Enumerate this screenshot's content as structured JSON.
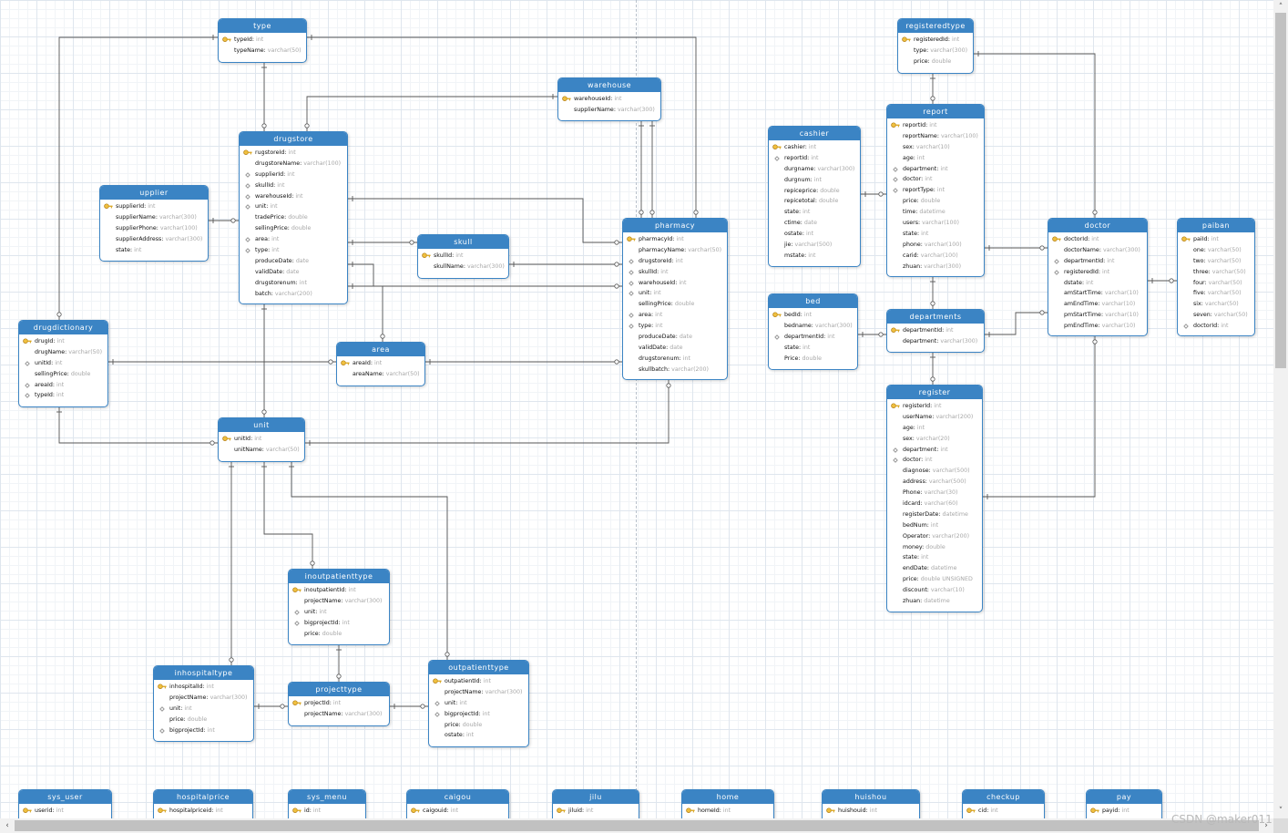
{
  "diagram": {
    "tables": [
      {
        "name": "type",
        "fields": [
          {
            "name": "typeId",
            "type": "int",
            "key": "pk"
          },
          {
            "name": "typeName",
            "type": "varchar(50)",
            "key": ""
          }
        ]
      },
      {
        "name": "warehouse",
        "fields": [
          {
            "name": "warehouseId",
            "type": "int",
            "key": "pk"
          },
          {
            "name": "supplierName",
            "type": "varchar(300)",
            "key": ""
          }
        ]
      },
      {
        "name": "drugstore",
        "fields": [
          {
            "name": "rugstoreId",
            "type": "int",
            "key": "pk"
          },
          {
            "name": "drugstoreName",
            "type": "varchar(100)",
            "key": ""
          },
          {
            "name": "supplierId",
            "type": "int",
            "key": "fk"
          },
          {
            "name": "skullId",
            "type": "int",
            "key": "fk"
          },
          {
            "name": "warehouseId",
            "type": "int",
            "key": "fk"
          },
          {
            "name": "unit",
            "type": "int",
            "key": "fk"
          },
          {
            "name": "tradePrice",
            "type": "double",
            "key": ""
          },
          {
            "name": "sellingPrice",
            "type": "double",
            "key": ""
          },
          {
            "name": "area",
            "type": "int",
            "key": "fk"
          },
          {
            "name": "type",
            "type": "int",
            "key": "fk"
          },
          {
            "name": "produceDate",
            "type": "date",
            "key": ""
          },
          {
            "name": "validDate",
            "type": "date",
            "key": ""
          },
          {
            "name": "drugstorenum",
            "type": "int",
            "key": ""
          },
          {
            "name": "batch",
            "type": "varchar(200)",
            "key": ""
          }
        ]
      },
      {
        "name": "upplier",
        "fields": [
          {
            "name": "supplierId",
            "type": "int",
            "key": "pk"
          },
          {
            "name": "supplierName",
            "type": "varchar(300)",
            "key": ""
          },
          {
            "name": "supplierPhone",
            "type": "varchar(100)",
            "key": ""
          },
          {
            "name": "supplierAddress",
            "type": "varchar(300)",
            "key": ""
          },
          {
            "name": "state",
            "type": "int",
            "key": ""
          }
        ]
      },
      {
        "name": "skull",
        "fields": [
          {
            "name": "skullId",
            "type": "int",
            "key": "pk"
          },
          {
            "name": "skullName",
            "type": "varchar(300)",
            "key": ""
          }
        ]
      },
      {
        "name": "pharmacy",
        "fields": [
          {
            "name": "pharmacyId",
            "type": "int",
            "key": "pk"
          },
          {
            "name": "pharmacyName",
            "type": "varchar(50)",
            "key": ""
          },
          {
            "name": "drugstoreId",
            "type": "int",
            "key": "fk"
          },
          {
            "name": "skullId",
            "type": "int",
            "key": "fk"
          },
          {
            "name": "warehouseId",
            "type": "int",
            "key": "fk"
          },
          {
            "name": "unit",
            "type": "int",
            "key": "fk"
          },
          {
            "name": "sellingPrice",
            "type": "double",
            "key": ""
          },
          {
            "name": "area",
            "type": "int",
            "key": "fk"
          },
          {
            "name": "type",
            "type": "int",
            "key": "fk"
          },
          {
            "name": "produceDate",
            "type": "date",
            "key": ""
          },
          {
            "name": "validDate",
            "type": "date",
            "key": ""
          },
          {
            "name": "drugstorenum",
            "type": "int",
            "key": ""
          },
          {
            "name": "skullbatch",
            "type": "varchar(200)",
            "key": ""
          }
        ]
      },
      {
        "name": "drugdictionary",
        "fields": [
          {
            "name": "drugId",
            "type": "int",
            "key": "pk"
          },
          {
            "name": "drugName",
            "type": "varchar(50)",
            "key": ""
          },
          {
            "name": "unitId",
            "type": "int",
            "key": "fk"
          },
          {
            "name": "sellingPrice",
            "type": "double",
            "key": ""
          },
          {
            "name": "areaId",
            "type": "int",
            "key": "fk"
          },
          {
            "name": "typeId",
            "type": "int",
            "key": "fk"
          }
        ]
      },
      {
        "name": "area",
        "fields": [
          {
            "name": "areaId",
            "type": "int",
            "key": "pk"
          },
          {
            "name": "areaName",
            "type": "varchar(50)",
            "key": ""
          }
        ]
      },
      {
        "name": "unit",
        "fields": [
          {
            "name": "unitId",
            "type": "int",
            "key": "pk"
          },
          {
            "name": "unitName",
            "type": "varchar(50)",
            "key": ""
          }
        ]
      },
      {
        "name": "inoutpatienttype",
        "fields": [
          {
            "name": "inoutpatientId",
            "type": "int",
            "key": "pk"
          },
          {
            "name": "projectName",
            "type": "varchar(300)",
            "key": ""
          },
          {
            "name": "unit",
            "type": "int",
            "key": "fk"
          },
          {
            "name": "bigprojectId",
            "type": "int",
            "key": "fk"
          },
          {
            "name": "price",
            "type": "double",
            "key": ""
          }
        ]
      },
      {
        "name": "inhospitaltype",
        "fields": [
          {
            "name": "inhospitalId",
            "type": "int",
            "key": "pk"
          },
          {
            "name": "projectName",
            "type": "varchar(300)",
            "key": ""
          },
          {
            "name": "unit",
            "type": "int",
            "key": "fk"
          },
          {
            "name": "price",
            "type": "double",
            "key": ""
          },
          {
            "name": "bigprojectId",
            "type": "int",
            "key": "fk"
          }
        ]
      },
      {
        "name": "projecttype",
        "fields": [
          {
            "name": "projectId",
            "type": "int",
            "key": "pk"
          },
          {
            "name": "projectName",
            "type": "varchar(300)",
            "key": ""
          }
        ]
      },
      {
        "name": "outpatienttype",
        "fields": [
          {
            "name": "outpatientId",
            "type": "int",
            "key": "pk"
          },
          {
            "name": "projectName",
            "type": "varchar(300)",
            "key": ""
          },
          {
            "name": "unit",
            "type": "int",
            "key": "fk"
          },
          {
            "name": "bigprojectId",
            "type": "int",
            "key": "fk"
          },
          {
            "name": "price",
            "type": "double",
            "key": ""
          },
          {
            "name": "ostate",
            "type": "int",
            "key": ""
          }
        ]
      },
      {
        "name": "registeredtype",
        "fields": [
          {
            "name": "registeredId",
            "type": "int",
            "key": "pk"
          },
          {
            "name": "type",
            "type": "varchar(300)",
            "key": ""
          },
          {
            "name": "price",
            "type": "double",
            "key": ""
          }
        ]
      },
      {
        "name": "report",
        "fields": [
          {
            "name": "reportId",
            "type": "int",
            "key": "pk"
          },
          {
            "name": "reportName",
            "type": "varchar(100)",
            "key": ""
          },
          {
            "name": "sex",
            "type": "varchar(10)",
            "key": ""
          },
          {
            "name": "age",
            "type": "int",
            "key": ""
          },
          {
            "name": "department",
            "type": "int",
            "key": "fk"
          },
          {
            "name": "doctor",
            "type": "int",
            "key": "fk"
          },
          {
            "name": "reportType",
            "type": "int",
            "key": "fk"
          },
          {
            "name": "price",
            "type": "double",
            "key": ""
          },
          {
            "name": "time",
            "type": "datetime",
            "key": ""
          },
          {
            "name": "users",
            "type": "varchar(100)",
            "key": ""
          },
          {
            "name": "state",
            "type": "int",
            "key": ""
          },
          {
            "name": "phone",
            "type": "varchar(100)",
            "key": ""
          },
          {
            "name": "carid",
            "type": "varchar(100)",
            "key": ""
          },
          {
            "name": "zhuan",
            "type": "varchar(300)",
            "key": ""
          }
        ]
      },
      {
        "name": "cashier",
        "fields": [
          {
            "name": "cashier",
            "type": "int",
            "key": "pk"
          },
          {
            "name": "reportId",
            "type": "int",
            "key": "fk"
          },
          {
            "name": "durgname",
            "type": "varchar(300)",
            "key": ""
          },
          {
            "name": "durgnum",
            "type": "int",
            "key": ""
          },
          {
            "name": "repiceprice",
            "type": "double",
            "key": ""
          },
          {
            "name": "repicetotal",
            "type": "double",
            "key": ""
          },
          {
            "name": "state",
            "type": "int",
            "key": ""
          },
          {
            "name": "ctime",
            "type": "date",
            "key": ""
          },
          {
            "name": "ostate",
            "type": "int",
            "key": ""
          },
          {
            "name": "jie",
            "type": "varchar(500)",
            "key": ""
          },
          {
            "name": "mstate",
            "type": "int",
            "key": ""
          }
        ]
      },
      {
        "name": "bed",
        "fields": [
          {
            "name": "bedId",
            "type": "int",
            "key": "pk"
          },
          {
            "name": "bedname",
            "type": "varchar(300)",
            "key": ""
          },
          {
            "name": "departmentId",
            "type": "int",
            "key": "fk"
          },
          {
            "name": "state",
            "type": "int",
            "key": ""
          },
          {
            "name": "Price",
            "type": "double",
            "key": ""
          }
        ]
      },
      {
        "name": "departments",
        "fields": [
          {
            "name": "departmentId",
            "type": "int",
            "key": "pk"
          },
          {
            "name": "department",
            "type": "varchar(300)",
            "key": ""
          }
        ]
      },
      {
        "name": "doctor",
        "fields": [
          {
            "name": "doctorId",
            "type": "int",
            "key": "pk"
          },
          {
            "name": "doctorName",
            "type": "varchar(300)",
            "key": ""
          },
          {
            "name": "departmentId",
            "type": "int",
            "key": "fk"
          },
          {
            "name": "registeredId",
            "type": "int",
            "key": "fk"
          },
          {
            "name": "dstate",
            "type": "int",
            "key": ""
          },
          {
            "name": "amStartTime",
            "type": "varchar(10)",
            "key": ""
          },
          {
            "name": "amEndTime",
            "type": "varchar(10)",
            "key": ""
          },
          {
            "name": "pmStartTime",
            "type": "varchar(10)",
            "key": ""
          },
          {
            "name": "pmEndTime",
            "type": "varchar(10)",
            "key": ""
          }
        ]
      },
      {
        "name": "paiban",
        "fields": [
          {
            "name": "paiId",
            "type": "int",
            "key": "pk"
          },
          {
            "name": "one",
            "type": "varchar(50)",
            "key": ""
          },
          {
            "name": "two",
            "type": "varchar(50)",
            "key": ""
          },
          {
            "name": "three",
            "type": "varchar(50)",
            "key": ""
          },
          {
            "name": "four",
            "type": "varchar(50)",
            "key": ""
          },
          {
            "name": "five",
            "type": "varchar(50)",
            "key": ""
          },
          {
            "name": "six",
            "type": "varchar(50)",
            "key": ""
          },
          {
            "name": "seven",
            "type": "varchar(50)",
            "key": ""
          },
          {
            "name": "doctorId",
            "type": "int",
            "key": "fk"
          }
        ]
      },
      {
        "name": "register",
        "fields": [
          {
            "name": "registerId",
            "type": "int",
            "key": "pk"
          },
          {
            "name": "userName",
            "type": "varchar(200)",
            "key": ""
          },
          {
            "name": "age",
            "type": "int",
            "key": ""
          },
          {
            "name": "sex",
            "type": "varchar(20)",
            "key": ""
          },
          {
            "name": "department",
            "type": "int",
            "key": "fk"
          },
          {
            "name": "doctor",
            "type": "int",
            "key": "fk"
          },
          {
            "name": "diagnose",
            "type": "varchar(500)",
            "key": ""
          },
          {
            "name": "address",
            "type": "varchar(500)",
            "key": ""
          },
          {
            "name": "Phone",
            "type": "varchar(30)",
            "key": ""
          },
          {
            "name": "idcard",
            "type": "varchar(60)",
            "key": ""
          },
          {
            "name": "registerDate",
            "type": "datetime",
            "key": ""
          },
          {
            "name": "bedNum",
            "type": "int",
            "key": ""
          },
          {
            "name": "Operator",
            "type": "varchar(200)",
            "key": ""
          },
          {
            "name": "money",
            "type": "double",
            "key": ""
          },
          {
            "name": "state",
            "type": "int",
            "key": ""
          },
          {
            "name": "endDate",
            "type": "datetime",
            "key": ""
          },
          {
            "name": "price",
            "type": "double UNSIGNED",
            "key": ""
          },
          {
            "name": "discount",
            "type": "varchar(10)",
            "key": ""
          },
          {
            "name": "zhuan",
            "type": "datetime",
            "key": ""
          }
        ]
      },
      {
        "name": "sys_user",
        "fields": [
          {
            "name": "userid",
            "type": "int",
            "key": "pk"
          }
        ]
      },
      {
        "name": "hospitalprice",
        "fields": [
          {
            "name": "hospitalpriceid",
            "type": "int",
            "key": "pk"
          }
        ]
      },
      {
        "name": "sys_menu",
        "fields": [
          {
            "name": "id",
            "type": "int",
            "key": "pk"
          }
        ]
      },
      {
        "name": "caigou",
        "fields": [
          {
            "name": "caigouid",
            "type": "int",
            "key": "pk"
          }
        ]
      },
      {
        "name": "jilu",
        "fields": [
          {
            "name": "jiluid",
            "type": "int",
            "key": "pk"
          }
        ]
      },
      {
        "name": "home",
        "fields": [
          {
            "name": "homeId",
            "type": "int",
            "key": "pk"
          }
        ]
      },
      {
        "name": "huishou",
        "fields": [
          {
            "name": "huishouid",
            "type": "int",
            "key": "pk"
          }
        ]
      },
      {
        "name": "checkup",
        "fields": [
          {
            "name": "cid",
            "type": "int",
            "key": "pk"
          }
        ]
      },
      {
        "name": "pay",
        "fields": [
          {
            "name": "payid",
            "type": "int",
            "key": "pk"
          }
        ]
      }
    ]
  },
  "watermark": "CSDN @maker011",
  "scrollbar": {
    "left_arrow": "‹",
    "right_arrow": "›",
    "up_arrow": "˄",
    "down_arrow": "˅"
  }
}
